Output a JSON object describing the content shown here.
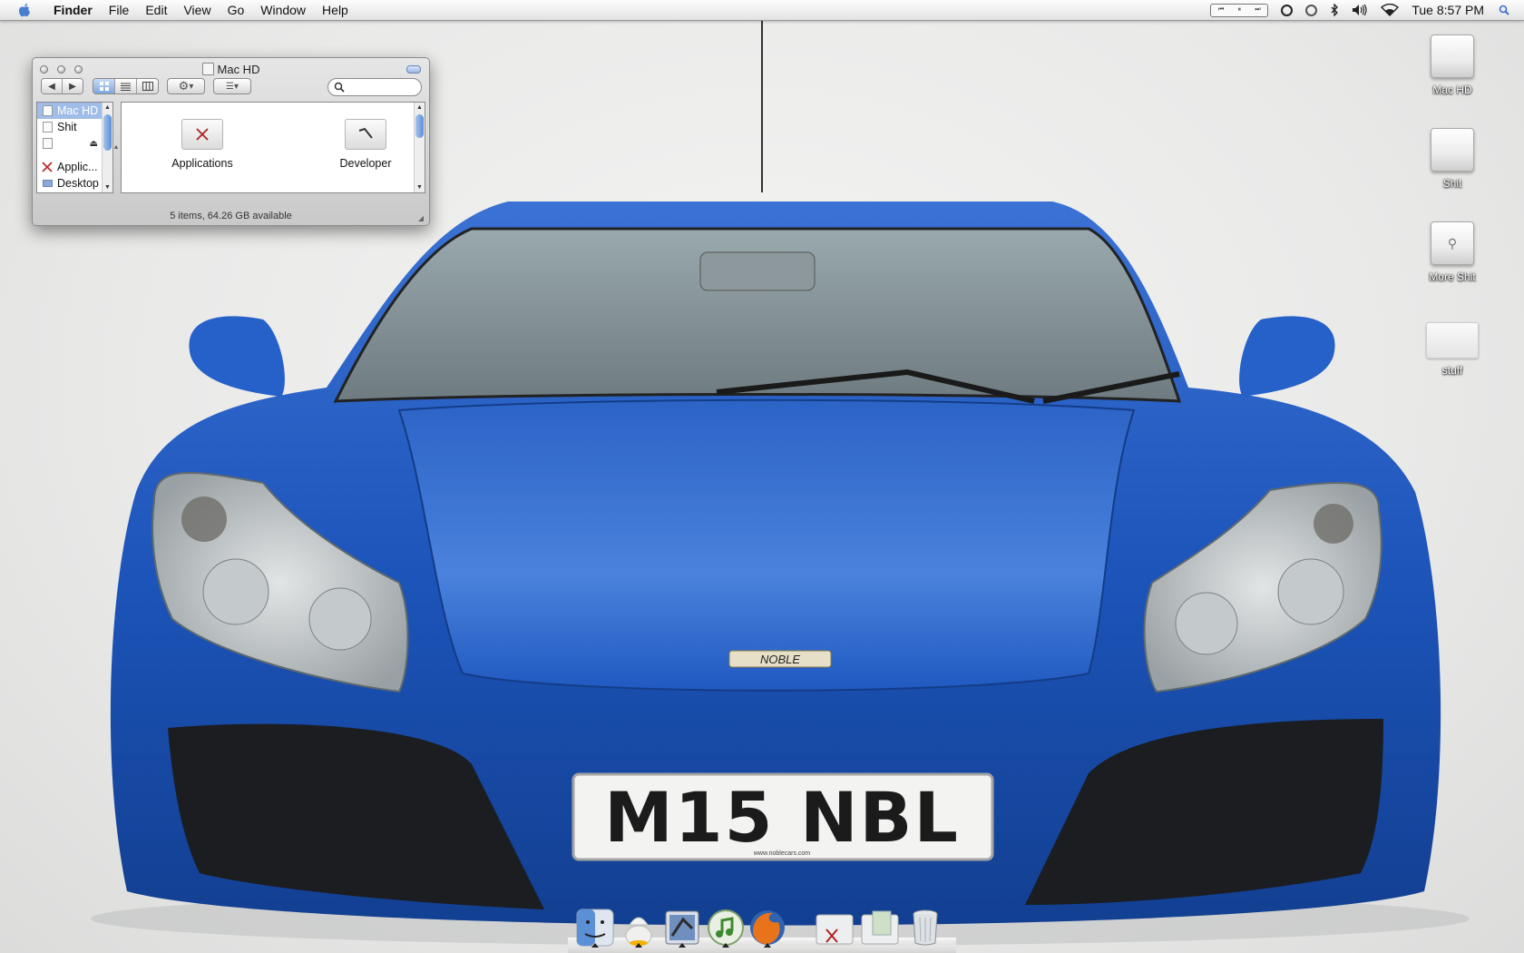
{
  "menubar": {
    "apple_icon": "apple-logo-icon",
    "app_name": "Finder",
    "menus": [
      "File",
      "Edit",
      "Window",
      "Go",
      "Help"
    ],
    "menu_file": "File",
    "menu_edit": "Edit",
    "menu_view": "View",
    "menu_go": "Go",
    "menu_window": "Window",
    "menu_help": "Help",
    "clock": "Tue 8:57 PM",
    "extras": [
      "itunes-controller-icon",
      "sync-icon",
      "time-machine-icon",
      "bluetooth-icon",
      "volume-icon",
      "wifi-icon",
      "spotlight-icon"
    ],
    "player_prev": "⏮",
    "player_pause": "⏸",
    "player_next": "⏭"
  },
  "finder": {
    "title": "Mac HD",
    "search_placeholder": "",
    "sidebar": {
      "devices": [
        {
          "label": "Mac HD",
          "selected": true
        },
        {
          "label": "Shit",
          "selected": false
        },
        {
          "label": "",
          "selected": false,
          "ejectable": true
        }
      ],
      "places": [
        {
          "label": "Applic..."
        },
        {
          "label": "Desktop"
        }
      ]
    },
    "items": [
      {
        "label": "Applications",
        "icon": "applications-folder-icon"
      },
      {
        "label": "Developer",
        "icon": "developer-folder-icon"
      }
    ],
    "status": "5 items, 64.26 GB available",
    "view_mode": "icon"
  },
  "desktop_icons": [
    {
      "label": "Mac HD",
      "icon": "hard-drive-icon"
    },
    {
      "label": "Shit",
      "icon": "hard-drive-icon"
    },
    {
      "label": "More Shit",
      "icon": "usb-drive-icon"
    },
    {
      "label": "stuff",
      "icon": "folder-icon"
    }
  ],
  "dock": {
    "items": [
      "finder-icon",
      "adium-icon",
      "mail-icon",
      "itunes-icon",
      "firefox-icon",
      "applications-stack-icon",
      "documents-stack-icon",
      "trash-icon"
    ]
  },
  "wallpaper": {
    "plate_text": "M15 NBL",
    "badge_text": "NOBLE",
    "plate_url": "www.noblecars.com",
    "car_color": "#1f56b6"
  }
}
